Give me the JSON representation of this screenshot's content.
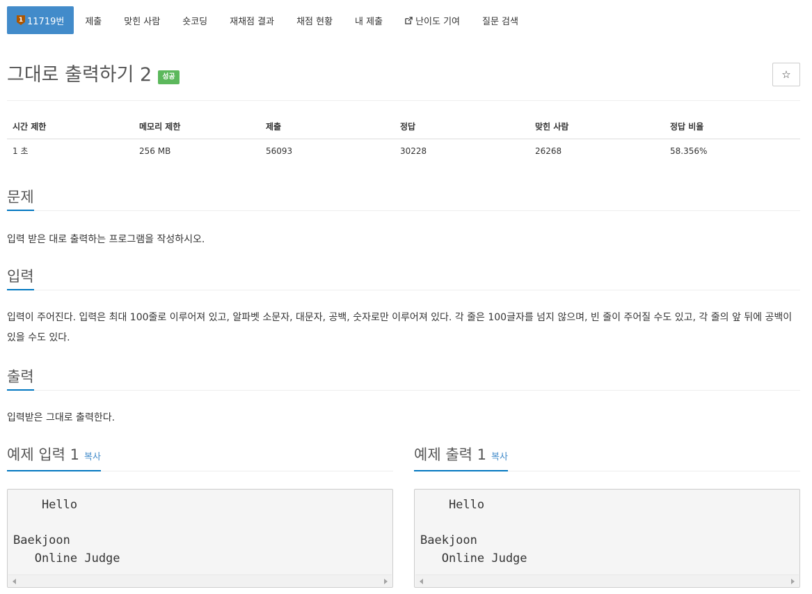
{
  "nav": {
    "problem_tab": {
      "tier_glyph": "1",
      "label": "11719번"
    },
    "tabs": [
      "제출",
      "맞힌 사람",
      "숏코딩",
      "재채점 결과",
      "채점 현황",
      "내 제출"
    ],
    "difficulty_contrib": "난이도 기여",
    "question_search": "질문 검색"
  },
  "problem": {
    "title": "그대로 출력하기 2",
    "status_badge": "성공",
    "star_glyph": "☆"
  },
  "info_table": {
    "headers": [
      "시간 제한",
      "메모리 제한",
      "제출",
      "정답",
      "맞힌 사람",
      "정답 비율"
    ],
    "values": [
      "1 초",
      "256 MB",
      "56093",
      "30228",
      "26268",
      "58.356%"
    ]
  },
  "sections": {
    "problem": {
      "heading": "문제",
      "text": "입력 받은 대로 출력하는 프로그램을 작성하시오."
    },
    "input": {
      "heading": "입력",
      "text": "입력이 주어진다. 입력은 최대 100줄로 이루어져 있고, 알파벳 소문자, 대문자, 공백, 숫자로만 이루어져 있다. 각 줄은 100글자를 넘지 않으며, 빈 줄이 주어질 수도 있고, 각 줄의 앞 뒤에 공백이 있을 수도 있다."
    },
    "output": {
      "heading": "출력",
      "text": "입력받은 그대로 출력한다."
    }
  },
  "samples": {
    "input": {
      "heading": "예제 입력 1",
      "copy": "복사",
      "content": "    Hello\n\nBaekjoon\n   Online Judge"
    },
    "output": {
      "heading": "예제 출력 1",
      "copy": "복사",
      "content": "    Hello\n\nBaekjoon\n   Online Judge"
    }
  },
  "colors": {
    "active_tab": "#428bca",
    "success_badge": "#5cb85c",
    "section_underline": "#0076c0",
    "link": "#428bca",
    "tier_bronze": "#ad5600"
  },
  "icons": [
    "tier-bronze-icon",
    "external-link-icon",
    "star-icon",
    "scroll-left-arrow-icon",
    "scroll-right-arrow-icon"
  ]
}
